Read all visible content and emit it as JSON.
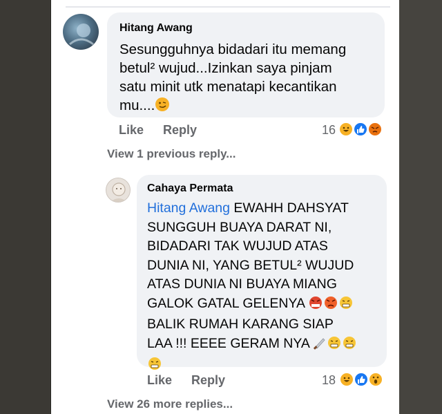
{
  "comment1": {
    "author": "Hitang Awang",
    "text": "Sesungguhnya bidadari itu memang\nbetul² wujud...Izinkan saya pinjam\nsatu minit utk menatapi kecantikan\nmu....",
    "like_label": "Like",
    "reply_label": "Reply",
    "reaction_count": "16"
  },
  "view_previous": "View 1 previous reply...",
  "reply1": {
    "author": "Cahaya Permata",
    "mention": "Hitang Awang",
    "line1": " EWAHH DAHSYAT",
    "text_rest": "SUNGGUH BUAYA DARAT NI,\nBIDADARI TAK WUJUD ATAS\nDUNIA NI, YANG BETUL² WUJUD\nATAS DUNIA NI BUAYA MIANG",
    "line_galok": "GALOK GATAL GELENYA ",
    "line_balik": "BALIK RUMAH KARANG SIAP",
    "line_laa": "LAA !!! EEEE GERAM NYA ",
    "like_label": "Like",
    "reply_label": "Reply",
    "reaction_count": "18"
  },
  "view_more": "View 26 more replies...",
  "colors": {
    "mention": "#216fdb",
    "like_blue": "#1877f2",
    "haha_yellow": "#f7b125",
    "angry_orange": "#e9710f"
  },
  "icons": [
    "smirk-emoji-icon",
    "angry-emoji-icon",
    "grimace-emoji-icon",
    "knife-icon",
    "haha-reaction-icon",
    "like-reaction-icon",
    "angry-reaction-icon",
    "wow-reaction-icon"
  ]
}
